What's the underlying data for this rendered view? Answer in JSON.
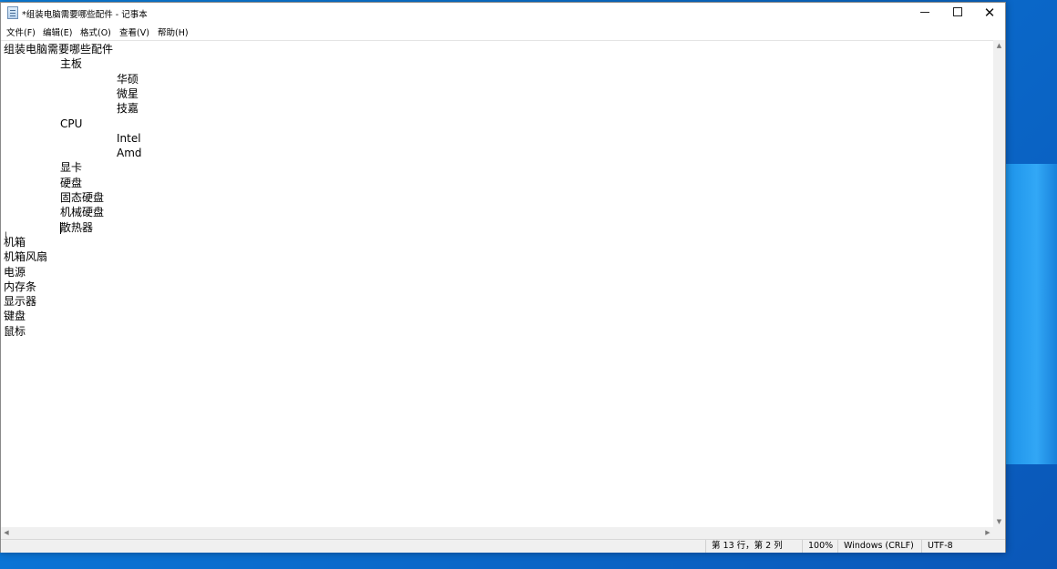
{
  "window": {
    "title": "*组装电脑需要哪些配件 - 记事本",
    "minimize_icon": "minimize-icon",
    "maximize_icon": "maximize-icon",
    "close_icon": "close-icon"
  },
  "menu": {
    "file": "文件(F)",
    "edit": "编辑(E)",
    "format": "格式(O)",
    "view": "查看(V)",
    "help": "帮助(H)"
  },
  "document": {
    "lines": [
      {
        "text": "组装电脑需要哪些配件",
        "indent": 0
      },
      {
        "text": "主板",
        "indent": 1
      },
      {
        "text": "华硕",
        "indent": 2
      },
      {
        "text": "微星",
        "indent": 2
      },
      {
        "text": "技嘉",
        "indent": 2
      },
      {
        "text": "CPU",
        "indent": 1
      },
      {
        "text": "Intel",
        "indent": 2
      },
      {
        "text": "Amd",
        "indent": 2
      },
      {
        "text": "显卡",
        "indent": 1
      },
      {
        "text": "硬盘",
        "indent": 1
      },
      {
        "text": "固态硬盘",
        "indent": 1
      },
      {
        "text": "机械硬盘",
        "indent": 1
      },
      {
        "text": "散热器",
        "indent": 1
      },
      {
        "text": "机箱",
        "indent": 0
      },
      {
        "text": "机箱风扇",
        "indent": 0
      },
      {
        "text": "电源",
        "indent": 0
      },
      {
        "text": "内存条",
        "indent": 0
      },
      {
        "text": "显示器",
        "indent": 0
      },
      {
        "text": "键盘",
        "indent": 0
      },
      {
        "text": "鼠标",
        "indent": 0
      }
    ]
  },
  "status": {
    "position": "第 13 行，第 2 列",
    "zoom": "100%",
    "line_ending": "Windows (CRLF)",
    "encoding": "UTF-8"
  }
}
